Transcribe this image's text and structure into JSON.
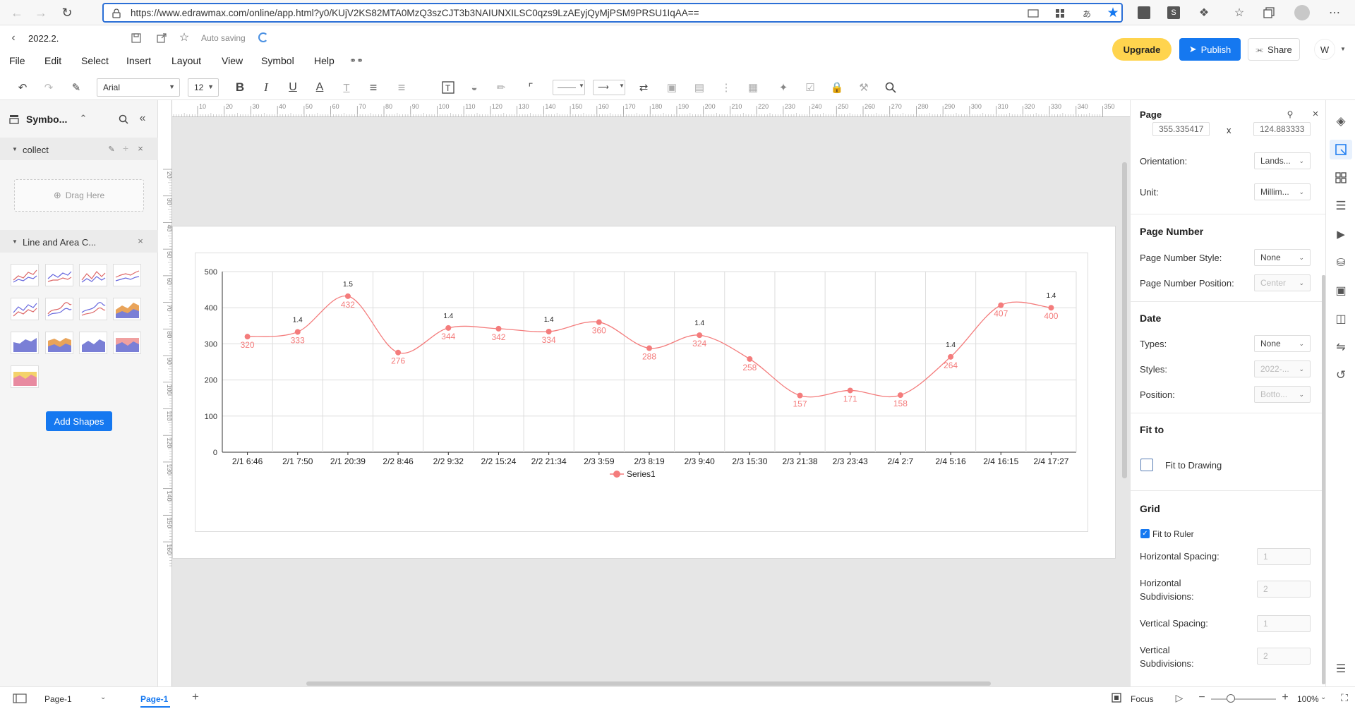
{
  "browser": {
    "url": "https://www.edrawmax.com/online/app.html?y0/KUjV2KS82MTA0MzQ3szCJT3b3NAIUNXILSC0qzs9LzAEyjQyMjPSM9PRSU1IqAA=="
  },
  "app": {
    "doc_title": "2022.2.",
    "save_status": "Auto saving",
    "menu": [
      "File",
      "Edit",
      "Select",
      "Insert",
      "Layout",
      "View",
      "Symbol",
      "Help"
    ],
    "upgrade_label": "Upgrade",
    "publish_label": "Publish",
    "share_label": "Share",
    "avatar_letter": "W"
  },
  "toolbar": {
    "font_name": "Arial",
    "font_size": "12"
  },
  "left_panel": {
    "title": "Symbo...",
    "collect_label": "collect",
    "drag_here": "Drag Here",
    "library_label": "Line and Area C...",
    "add_shapes_label": "Add Shapes"
  },
  "ruler": {
    "h_ticks": [
      "10",
      "20",
      "30",
      "40",
      "50",
      "60",
      "70",
      "80",
      "90",
      "100",
      "110",
      "120",
      "130",
      "140",
      "150",
      "160",
      "170",
      "180",
      "190",
      "200",
      "210",
      "220",
      "230",
      "240",
      "250",
      "260",
      "270",
      "280",
      "290",
      "300",
      "310",
      "320",
      "330",
      "340",
      "350"
    ],
    "v_ticks": [
      "20",
      "30",
      "40",
      "50",
      "60",
      "70",
      "80",
      "90",
      "100",
      "110",
      "120",
      "130",
      "140",
      "150",
      "160"
    ]
  },
  "right_panel": {
    "title": "Page",
    "width_value": "355.335417",
    "x_sep": "x",
    "height_value": "124.883333",
    "orientation_label": "Orientation:",
    "orientation_value": "Lands...",
    "unit_label": "Unit:",
    "unit_value": "Millim...",
    "page_number_heading": "Page Number",
    "page_number_style_label": "Page Number Style:",
    "page_number_style_value": "None",
    "page_number_position_label": "Page Number Position:",
    "page_number_position_value": "Center",
    "date_heading": "Date",
    "types_label": "Types:",
    "types_value": "None",
    "styles_label": "Styles:",
    "styles_value": "2022-...",
    "position_label": "Position:",
    "position_value": "Botto...",
    "fit_to_heading": "Fit to",
    "fit_to_drawing_label": "Fit to Drawing",
    "grid_heading": "Grid",
    "fit_to_ruler_label": "Fit to Ruler",
    "fit_to_ruler_checked": true,
    "h_spacing_label": "Horizontal Spacing:",
    "h_spacing_value": "1",
    "h_subdiv_label_1": "Horizontal",
    "h_subdiv_label_2": "Subdivisions:",
    "h_subdiv_value": "2",
    "v_spacing_label": "Vertical Spacing:",
    "v_spacing_value": "1",
    "v_subdiv_label_1": "Vertical",
    "v_subdiv_label_2": "Subdivisions:",
    "v_subdiv_value": "2"
  },
  "status_bar": {
    "page_select": "Page-1",
    "active_tab": "Page-1",
    "focus_label": "Focus",
    "zoom_value": "100%",
    "zoom_fraction": 0.3
  },
  "colors": {
    "accent": "#1578f0",
    "series": "#f47c7c",
    "upgrade": "#ffd44e"
  },
  "chart_data": {
    "type": "line",
    "categories": [
      "2/1 6:46",
      "2/1 7:50",
      "2/1 20:39",
      "2/2 8:46",
      "2/2 9:32",
      "2/2 15:24",
      "2/2 21:34",
      "2/3 3:59",
      "2/3 8:19",
      "2/3 9:40",
      "2/3 15:30",
      "2/3 21:38",
      "2/3 23:43",
      "2/4 2:7",
      "2/4 5:16",
      "2/4 16:15",
      "2/4 17:27"
    ],
    "series": [
      {
        "name": "Series1",
        "values": [
          320,
          333,
          432,
          276,
          344,
          342,
          334,
          360,
          288,
          324,
          258,
          157,
          171,
          158,
          264,
          407,
          400
        ]
      }
    ],
    "annotations": [
      {
        "index": 1,
        "text": "1.4"
      },
      {
        "index": 2,
        "text": "1.5"
      },
      {
        "index": 4,
        "text": "1.4"
      },
      {
        "index": 6,
        "text": "1.4"
      },
      {
        "index": 9,
        "text": "1.4"
      },
      {
        "index": 14,
        "text": "1.4"
      },
      {
        "index": 16,
        "text": "1.4"
      }
    ],
    "ylim": [
      0,
      500
    ],
    "yticks": [
      "0",
      "100",
      "200",
      "300",
      "400",
      "500"
    ],
    "legend": "bottom-center",
    "grid": true
  }
}
